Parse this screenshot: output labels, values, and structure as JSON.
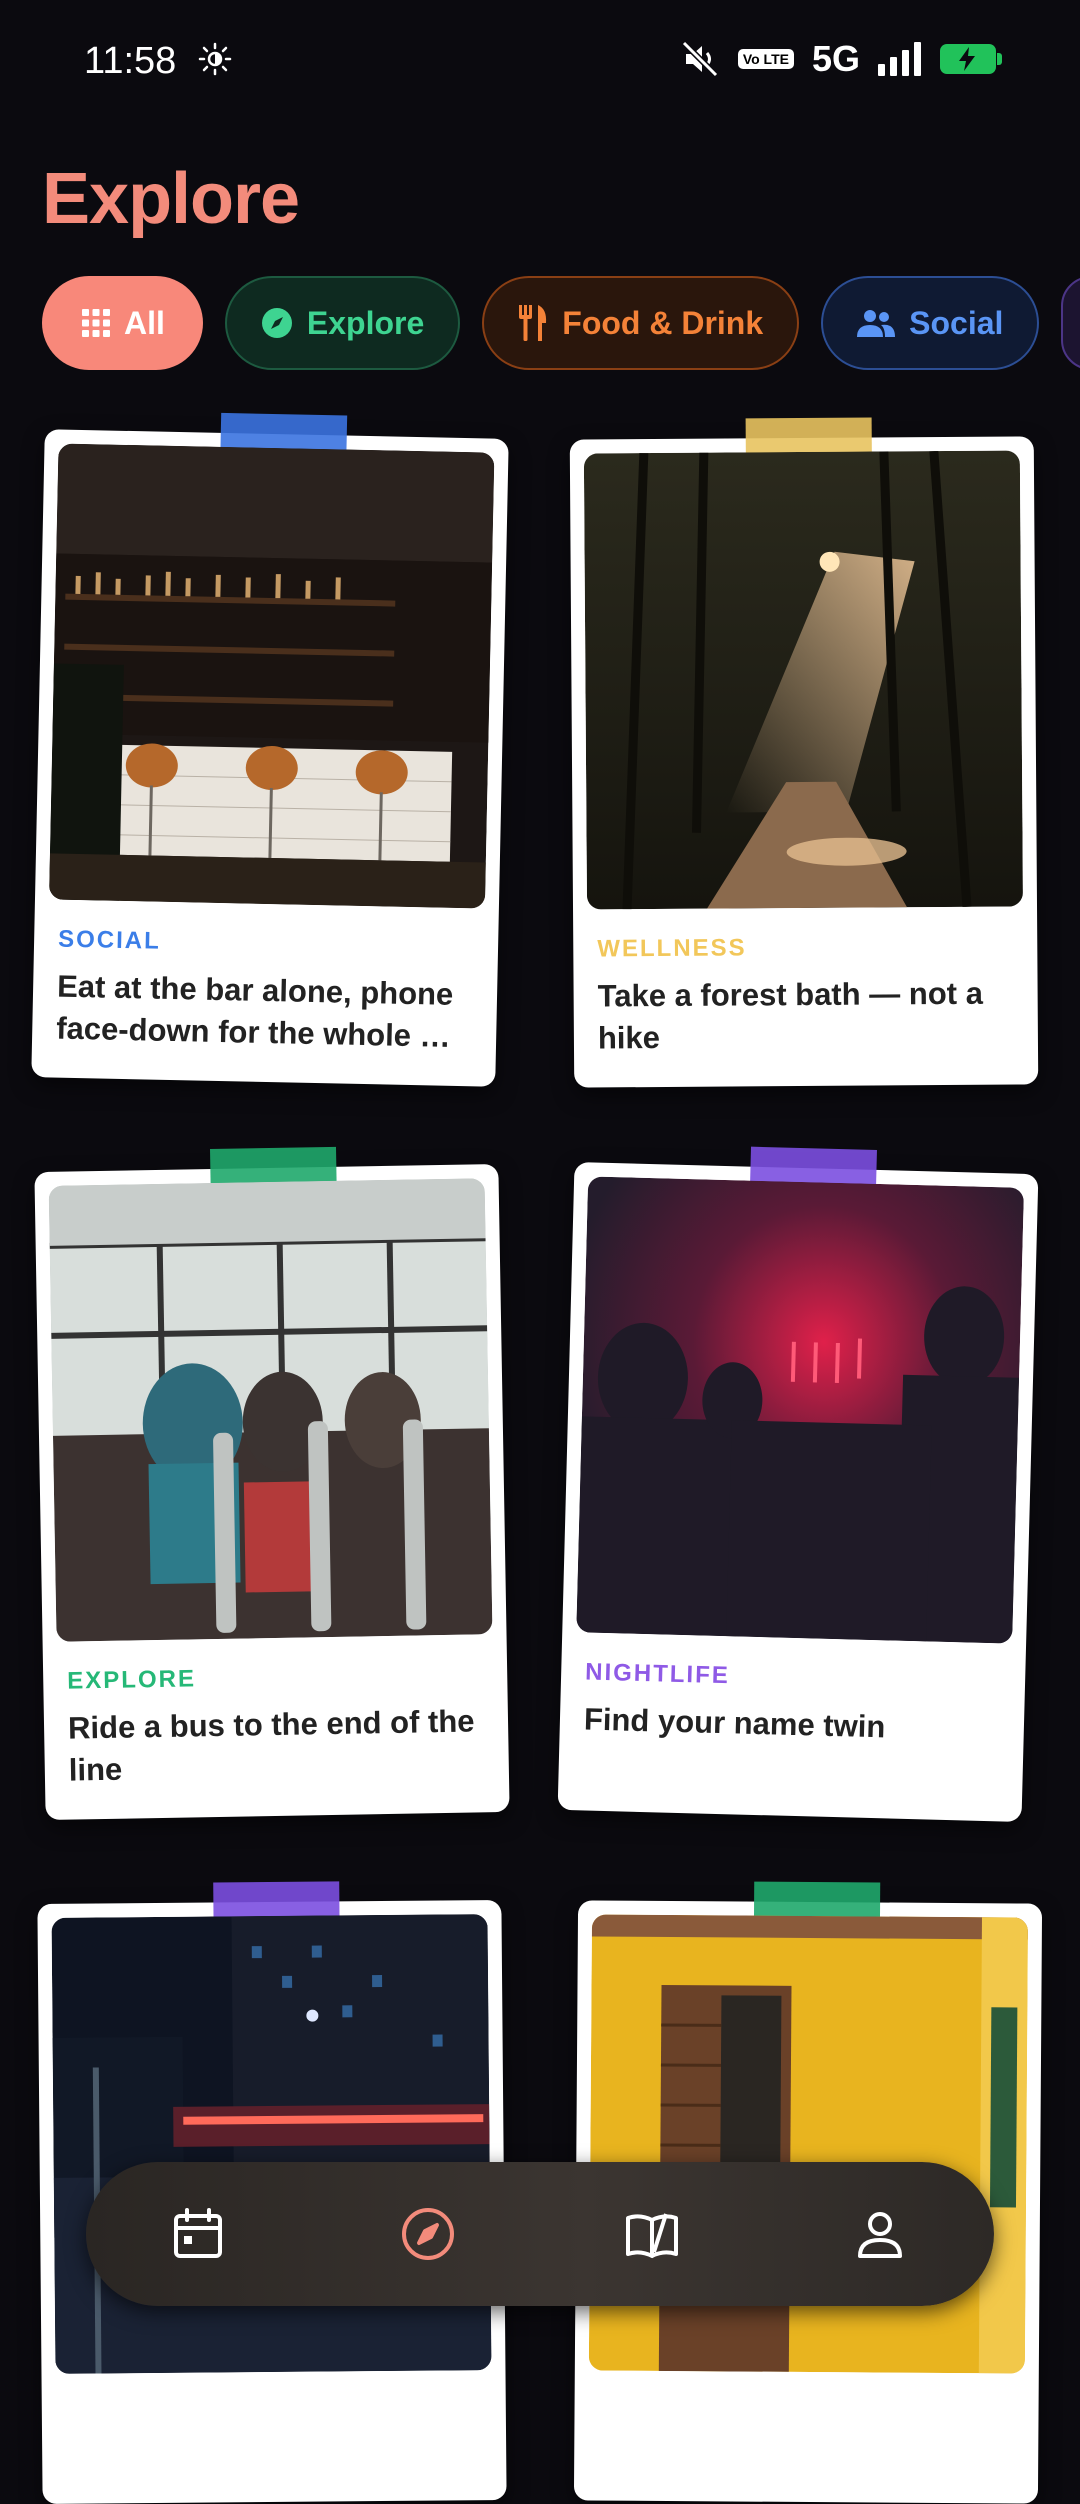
{
  "status_bar": {
    "time": "11:58",
    "volte": "Vo LTE",
    "network": "5G"
  },
  "page_title": "Explore",
  "chips": [
    {
      "label": "All",
      "icon": "grid-icon"
    },
    {
      "label": "Explore",
      "icon": "compass-icon"
    },
    {
      "label": "Food & Drink",
      "icon": "fork-knife-icon"
    },
    {
      "label": "Social",
      "icon": "people-icon"
    }
  ],
  "cards": [
    {
      "category": "SOCIAL",
      "category_color": "#3b7ee8",
      "tape_color": "#3b73e0",
      "text": "Eat at the bar alone, phone face-down for the whole …"
    },
    {
      "category": "WELLNESS",
      "category_color": "#f2c75a",
      "tape_color": "#e8c35f",
      "text": "Take a forest bath — not a hike"
    },
    {
      "category": "EXPLORE",
      "category_color": "#26b877",
      "tape_color": "#1fa86b",
      "text": "Ride a bus to the end of the line"
    },
    {
      "category": "NIGHTLIFE",
      "category_color": "#8f5ae6",
      "tape_color": "#7b4fe0",
      "text": "Find your name twin"
    },
    {
      "tape_color": "#7b4fe0"
    },
    {
      "tape_color": "#1fa86b"
    }
  ],
  "bottom_nav": [
    "calendar-icon",
    "compass-icon",
    "book-icon",
    "profile-icon"
  ],
  "colors": {
    "accent": "#f38b7b",
    "background": "#0b0a0f"
  }
}
